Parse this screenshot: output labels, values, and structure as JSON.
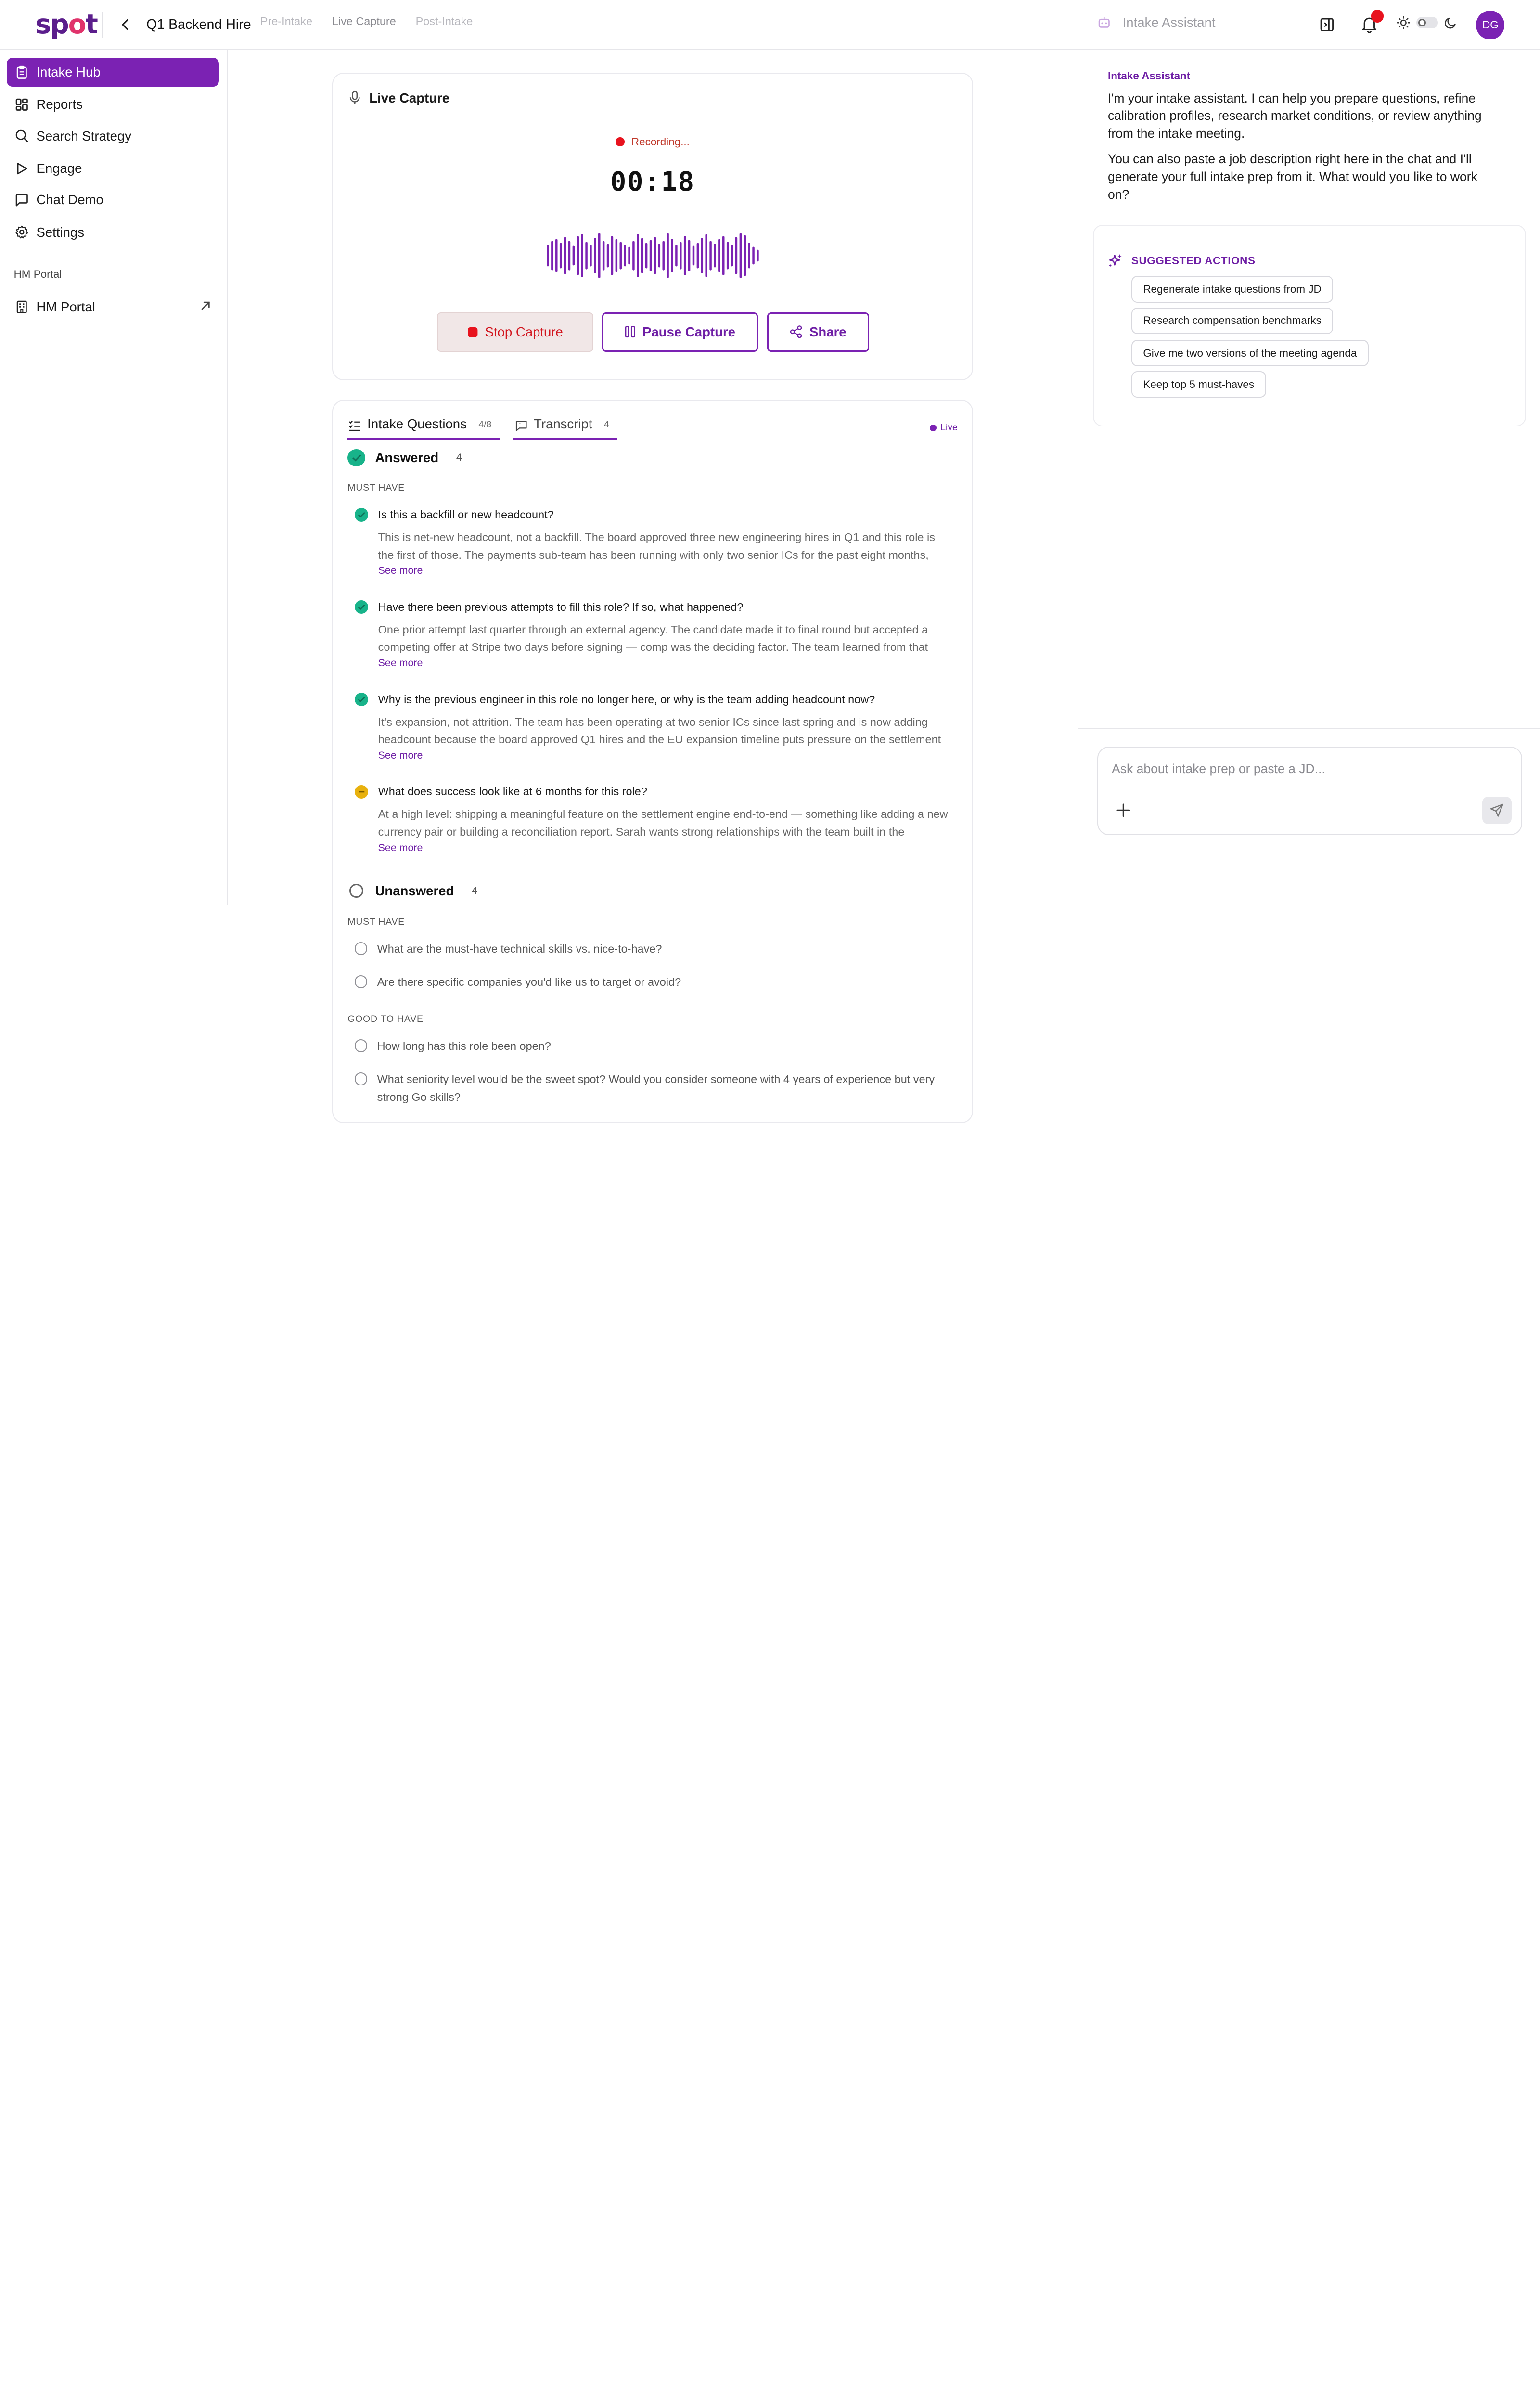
{
  "header": {
    "logo": {
      "pre": "sp",
      "o": "o",
      "post": "t"
    },
    "project_title": "Q1 Backend Hire",
    "steps": [
      "Pre-Intake",
      "Live Capture",
      "Post-Intake"
    ],
    "assistant_title": "Intake Assistant",
    "user_initials": "DG"
  },
  "sidebar": {
    "items": [
      {
        "label": "Intake Hub",
        "icon": "clipboard-icon"
      },
      {
        "label": "Reports",
        "icon": "grid-icon"
      },
      {
        "label": "Search Strategy",
        "icon": "search-icon"
      },
      {
        "label": "Engage",
        "icon": "play-icon"
      },
      {
        "label": "Chat Demo",
        "icon": "chat-icon"
      },
      {
        "label": "Settings",
        "icon": "gear-icon"
      }
    ],
    "section_label": "HM Portal",
    "portal_item": {
      "label": "HM Portal",
      "icon": "building-icon"
    }
  },
  "capture": {
    "title": "Live Capture",
    "status": "Recording...",
    "timer": "00:18",
    "stop_label": "Stop Capture",
    "pause_label": "Pause Capture",
    "share_label": "Share"
  },
  "questions": {
    "tabs": [
      {
        "label": "Intake Questions",
        "count": "4/8"
      },
      {
        "label": "Transcript",
        "count": "4"
      }
    ],
    "live_label": "Live",
    "answered": {
      "label": "Answered",
      "count": "4",
      "category": "MUST HAVE",
      "items": [
        {
          "question": "Is this a backfill or new headcount?",
          "status": "done",
          "answer": "This is net-new headcount, not a backfill. The board approved three new engineering hires in Q1 and this role is the first of those. The payments sub-team has been running with only two senior ICs for the past eight months,",
          "see_more": "See more"
        },
        {
          "question": "Have there been previous attempts to fill this role? If so, what happened?",
          "status": "done",
          "answer": "One prior attempt last quarter through an external agency. The candidate made it to final round but accepted a competing offer at Stripe two days before signing — comp was the deciding factor. The team learned from that",
          "see_more": "See more"
        },
        {
          "question": "Why is the previous engineer in this role no longer here, or why is the team adding headcount now?",
          "status": "done",
          "answer": "It's expansion, not attrition. The team has been operating at two senior ICs since last spring and is now adding headcount because the board approved Q1 hires and the EU expansion timeline puts pressure on the settlement",
          "see_more": "See more"
        },
        {
          "question": "What does success look like at 6 months for this role?",
          "status": "partial",
          "answer": "At a high level: shipping a meaningful feature on the settlement engine end-to-end — something like adding a new currency pair or building a reconciliation report. Sarah wants strong relationships with the team built in the",
          "see_more": "See more"
        }
      ]
    },
    "unanswered": {
      "label": "Unanswered",
      "count": "4",
      "groups": [
        {
          "category": "MUST HAVE",
          "items": [
            "What are the must-have technical skills vs. nice-to-have?",
            "Are there specific companies you'd like us to target or avoid?"
          ]
        },
        {
          "category": "GOOD TO HAVE",
          "items": [
            "How long has this role been open?",
            "What seniority level would be the sweet spot? Would you consider someone with 4 years of experience but very strong Go skills?"
          ]
        }
      ]
    }
  },
  "assistant": {
    "label": "Intake Assistant",
    "message_1": "I'm your intake assistant. I can help you prepare questions, refine calibration profiles, research market conditions, or review anything from the intake meeting.",
    "message_2": "You can also paste a job description right here in the chat and I'll generate your full intake prep from it. What would you like to work on?",
    "suggested_title": "SUGGESTED ACTIONS",
    "suggestions": [
      "Regenerate intake questions from JD",
      "Research compensation benchmarks",
      "Give me two versions of the meeting agenda",
      "Keep top 5 must-haves"
    ],
    "input_placeholder": "Ask about intake prep or paste a JD..."
  },
  "colors": {
    "accent": "#7b22b3",
    "recording": "#e8131e",
    "answered": "#18b38a",
    "partial": "#e8b10e"
  }
}
